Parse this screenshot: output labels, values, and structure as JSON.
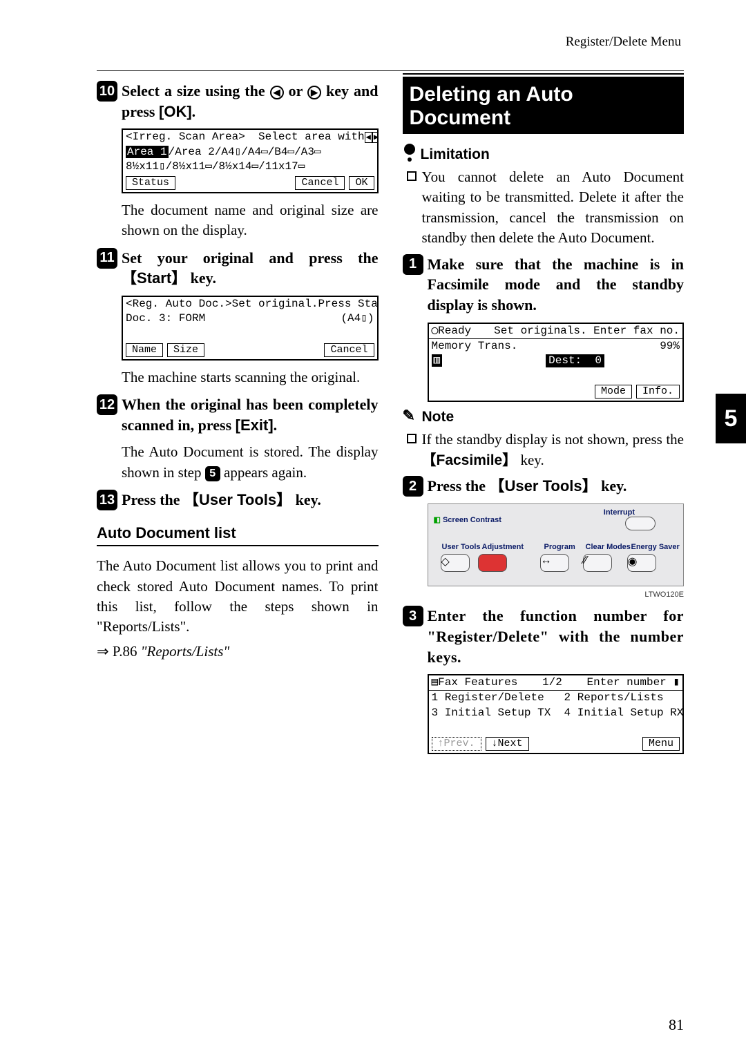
{
  "header": {
    "section": "Register/Delete Menu"
  },
  "page_number": "81",
  "side_tab": "5",
  "left": {
    "step10": {
      "num": "10",
      "text_a": "Select a size using the ",
      "text_b": " or ",
      "text_c": " key and press ",
      "ok": "[OK]",
      "period": "."
    },
    "lcd1": {
      "line1": "<Irreg. Scan Area>  Select area with",
      "line2a": "Area 1",
      "line2b": "/Area 2/A4▯/A4▭/B4▭/A3▭",
      "line3": "8½x11▯/8½x11▭/8½x14▭/11x17▭",
      "btn_status": "Status",
      "btn_cancel": "Cancel",
      "btn_ok": "OK"
    },
    "after10": "The document name and original size are shown on the display.",
    "step11": {
      "num": "11",
      "text_a": "Set your original and press the ",
      "key": "Start",
      "text_b": " key."
    },
    "lcd2": {
      "line1": "<Reg. Auto Doc.>Set original.Press Start",
      "line2l": "Doc. 3: FORM",
      "line2r": "(A4▯)",
      "btn_name": "Name",
      "btn_size": "Size",
      "btn_cancel": "Cancel"
    },
    "after11": "The machine starts scanning the original.",
    "step12": {
      "num": "12",
      "text_a": "When the original has been completely scanned in, press ",
      "exit": "[Exit]",
      "period": "."
    },
    "after12_a": "The Auto Document is stored. The display shown in step ",
    "after12_ref": "5",
    "after12_b": " appears again.",
    "step13": {
      "num": "13",
      "text_a": "Press the ",
      "key": "User Tools",
      "text_b": " key."
    },
    "sub_title": "Auto Document list",
    "autodoc_p1": "The Auto Document list allows you to print and check stored Auto Document names. To print this list, follow the steps shown in \"Reports/Lists\".",
    "autodoc_p2a": "⇒ P.86 ",
    "autodoc_p2b": "\"Reports/Lists\""
  },
  "right": {
    "title": "Deleting an Auto Document",
    "limitation_label": "Limitation",
    "limitation_text": "You cannot delete an Auto Document waiting to be transmitted. Delete it after the transmission, cancel the transmission on standby then delete the Auto Document.",
    "step1": {
      "num": "1",
      "text": "Make sure that the machine is in Facsimile mode and the standby display is shown."
    },
    "lcd3": {
      "line1l": "◯Ready",
      "line1r": "Set originals. Enter fax no.",
      "line2l": "Memory Trans.",
      "line2r": "99%",
      "line3_dest": "Dest:  0",
      "btn_mode": "Mode",
      "btn_info": "Info."
    },
    "note_label": "Note",
    "note_text_a": "If the standby display is not shown, press the ",
    "note_key": "Facsimile",
    "note_text_b": " key.",
    "step2": {
      "num": "2",
      "text_a": "Press the ",
      "key": "User Tools",
      "text_b": " key."
    },
    "panel": {
      "screen_contrast": "Screen Contrast",
      "user_tools": "User Tools",
      "adjustment": "Adjustment",
      "program": "Program",
      "clear_modes": "Clear Modes",
      "energy_saver": "Energy Saver",
      "interrupt": "Interrupt",
      "caption": "LTWO120E"
    },
    "step3": {
      "num": "3",
      "text": "Enter the function number for \"Register/Delete\" with the number keys."
    },
    "lcd4": {
      "line1l": "▤Fax Features",
      "line1m": "1/2",
      "line1r": "Enter number ▮",
      "line2": "1 Register/Delete   2 Reports/Lists",
      "line3": "3 Initial Setup TX  4 Initial Setup RX",
      "btn_prev": "↑Prev.",
      "btn_next": "↓Next",
      "btn_menu": "Menu"
    }
  }
}
